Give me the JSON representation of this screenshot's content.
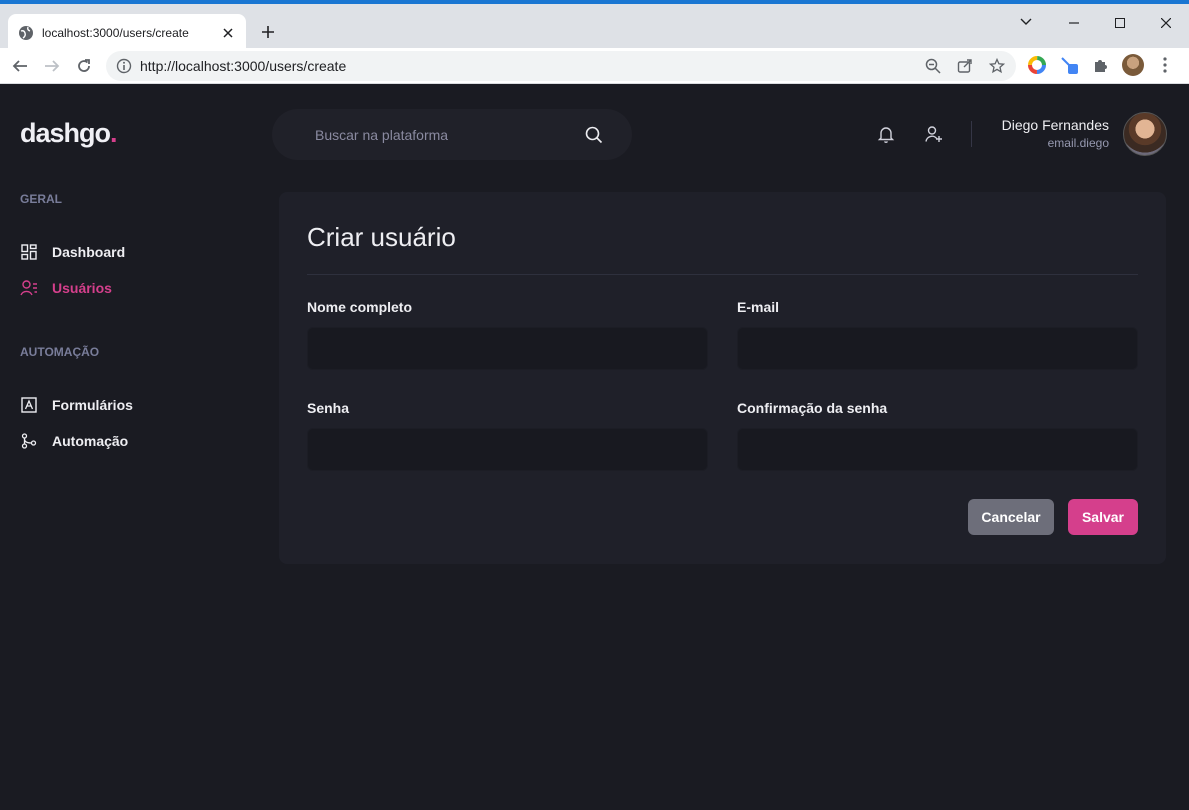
{
  "browser": {
    "tab_title": "localhost:3000/users/create",
    "url": "http://localhost:3000/users/create"
  },
  "app": {
    "logo": "dashgo",
    "logo_dot": ".",
    "accent_color": "#d53f8c",
    "search": {
      "placeholder": "Buscar na plataforma"
    },
    "user": {
      "name": "Diego Fernandes",
      "email": "email.diego"
    }
  },
  "sidebar": {
    "sections": [
      {
        "title": "GERAL",
        "items": [
          {
            "label": "Dashboard",
            "icon": "dashboard-icon"
          },
          {
            "label": "Usuários",
            "icon": "users-icon",
            "active": true
          }
        ]
      },
      {
        "title": "AUTOMAÇÃO",
        "items": [
          {
            "label": "Formulários",
            "icon": "form-icon"
          },
          {
            "label": "Automação",
            "icon": "git-merge-icon"
          }
        ]
      }
    ]
  },
  "form": {
    "title": "Criar usuário",
    "fields": [
      {
        "label": "Nome completo",
        "value": ""
      },
      {
        "label": "E-mail",
        "value": ""
      },
      {
        "label": "Senha",
        "value": ""
      },
      {
        "label": "Confirmação da senha",
        "value": ""
      }
    ],
    "cancel_label": "Cancelar",
    "save_label": "Salvar"
  }
}
